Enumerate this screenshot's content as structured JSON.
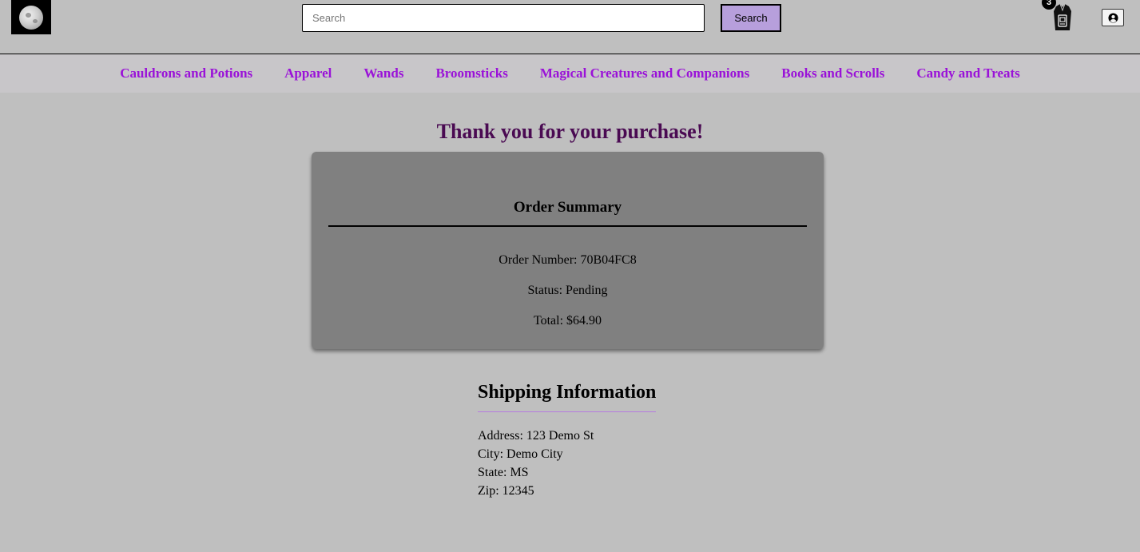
{
  "header": {
    "logo_icon": "moon-logo-icon",
    "search": {
      "placeholder": "Search",
      "value": "",
      "button_label": "Search"
    },
    "cart": {
      "icon": "cloak-cart-icon",
      "count": "3"
    },
    "account": {
      "icon": "user-circle-icon"
    }
  },
  "nav": {
    "items": [
      {
        "label": "Cauldrons and Potions"
      },
      {
        "label": "Apparel"
      },
      {
        "label": "Wands"
      },
      {
        "label": "Broomsticks"
      },
      {
        "label": "Magical Creatures and Companions"
      },
      {
        "label": "Books and Scrolls"
      },
      {
        "label": "Candy and Treats"
      }
    ]
  },
  "main": {
    "thanks": "Thank you for your purchase!",
    "summary": {
      "title": "Order Summary",
      "order_number": "Order Number: 70B04FC8",
      "status": "Status: Pending",
      "total": "Total: $64.90"
    },
    "shipping": {
      "title": "Shipping Information",
      "address": "Address: 123 Demo St",
      "city": "City: Demo City",
      "state": "State: MS",
      "zip": "Zip: 12345"
    }
  },
  "colors": {
    "page_bg": "#bfbfbf",
    "nav_bg": "#c8c6c9",
    "nav_link": "#9a12d8",
    "thanks_text": "#4a0a52",
    "card_bg": "#808080",
    "search_button_bg": "#b79fdc",
    "shipping_rule": "#b57be0"
  }
}
